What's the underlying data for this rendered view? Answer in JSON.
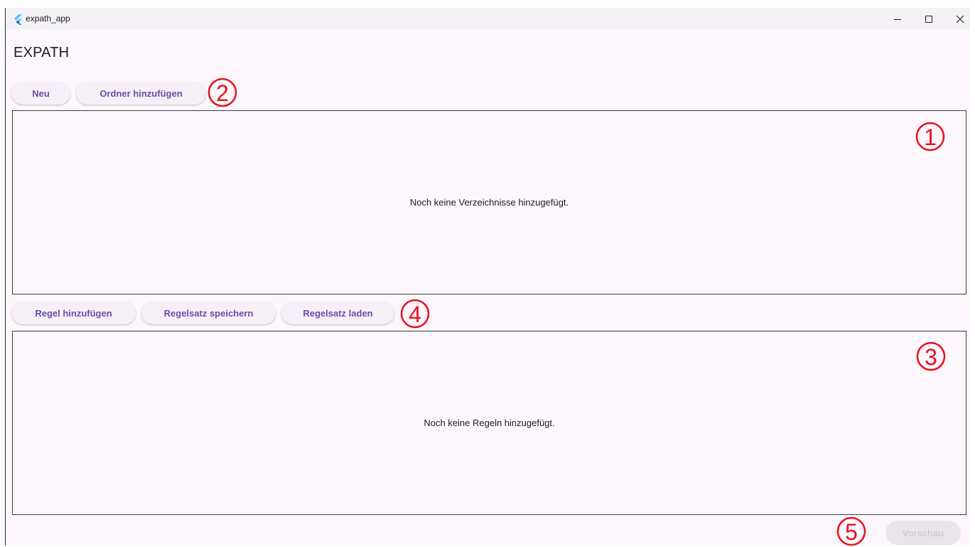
{
  "window": {
    "title": "expath_app",
    "controls": {
      "minimize_icon": "minimize-icon",
      "maximize_icon": "maximize-icon",
      "close_icon": "close-icon"
    }
  },
  "header": {
    "title": "EXPATH"
  },
  "toolbar_folders": {
    "new_label": "Neu",
    "add_folder_label": "Ordner hinzufügen"
  },
  "directories_panel": {
    "empty_message": "Noch keine Verzeichnisse hinzugefügt."
  },
  "toolbar_rules": {
    "add_rule_label": "Regel hinzufügen",
    "save_ruleset_label": "Regelsatz speichern",
    "load_ruleset_label": "Regelsatz laden"
  },
  "rules_panel": {
    "empty_message": "Noch keine Regeln hinzugefügt."
  },
  "footer": {
    "preview_label": "Vorschau",
    "preview_enabled": false
  },
  "annotations": {
    "marker_1": "1",
    "marker_2": "2",
    "marker_3": "3",
    "marker_4": "4",
    "marker_5": "5",
    "color": "#e8101a"
  },
  "colors": {
    "accent": "#6750a4",
    "background": "#fdf7fd",
    "button_bg": "#f6eff7"
  }
}
